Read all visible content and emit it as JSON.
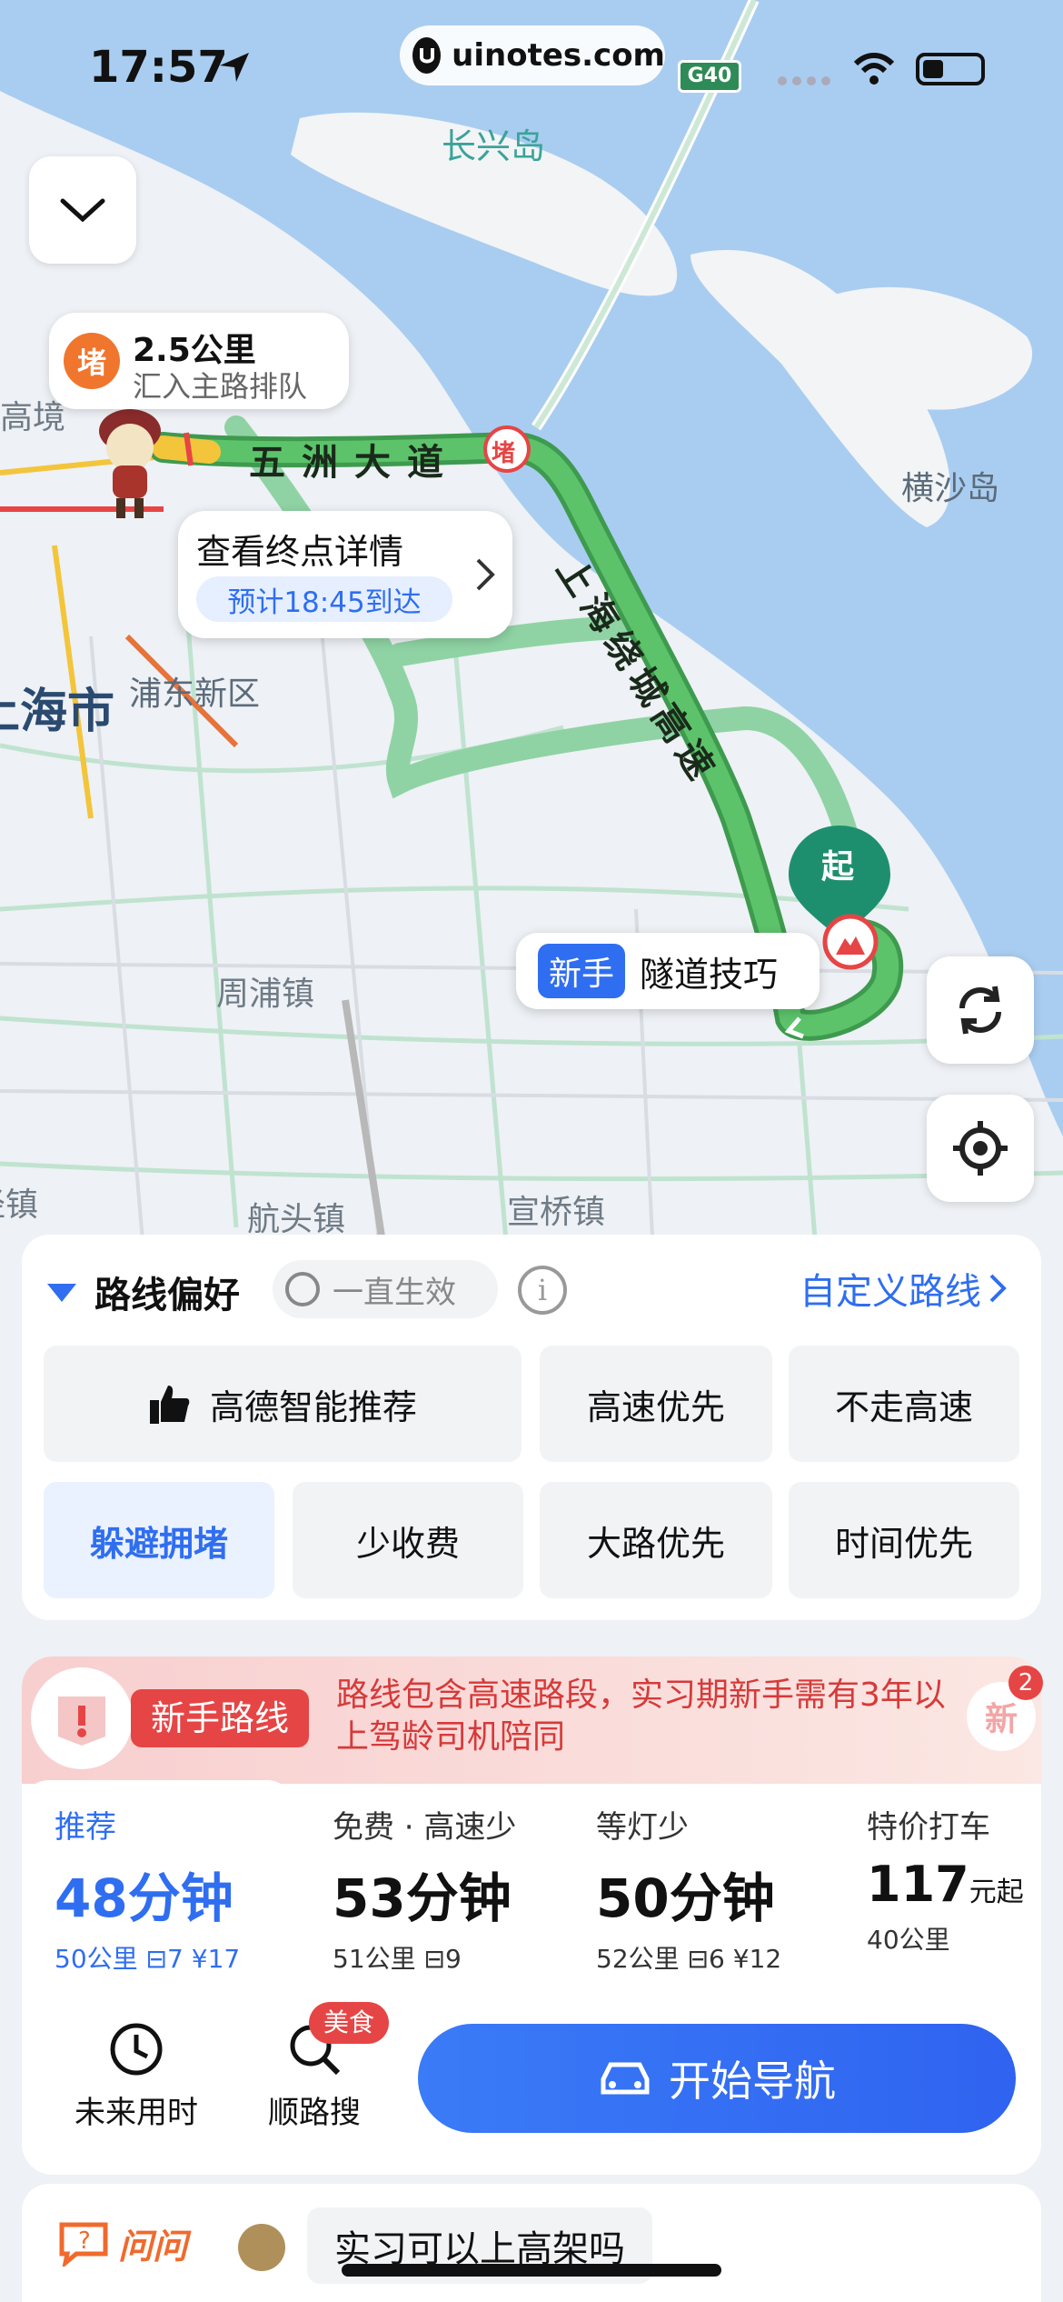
{
  "status_bar": {
    "time": "17:57",
    "url": "uinotes.com",
    "highway_sign": "G40"
  },
  "map": {
    "labels": {
      "changxing_island": "长兴岛",
      "hengsha_island": "横沙岛",
      "gaojing": "高境",
      "shanghai_city": "上海市",
      "pudong": "浦东新区",
      "zhoupu": "周浦镇",
      "hangtou": "航头镇",
      "xuanqiao": "宣桥镇",
      "jing_town": "泾镇"
    },
    "road_wuzhou": "五洲大道",
    "road_ring": "上海绕城高速",
    "jam_marker": "堵",
    "start_marker": "起"
  },
  "jam_bubble": {
    "badge": "堵",
    "distance": "2.5公里",
    "desc": "汇入主路排队"
  },
  "dest_bubble": {
    "title": "查看终点详情",
    "eta": "预计18:45到达"
  },
  "tip_bubble": {
    "badge": "新手",
    "text": "隧道技巧"
  },
  "preferences": {
    "title": "路线偏好",
    "toggle_label": "一直生效",
    "custom_link": "自定义路线",
    "row1": [
      "高德智能推荐",
      "高速优先",
      "不走高速"
    ],
    "row2": [
      "躲避拥堵",
      "少收费",
      "大路优先",
      "时间优先"
    ],
    "active": "躲避拥堵"
  },
  "novice_banner": {
    "tag": "新手路线",
    "message": "路线包含高速路段，实习期新手需有3年以上驾龄司机陪同",
    "badge_text": "新",
    "badge_count": "2"
  },
  "routes": [
    {
      "name": "推荐",
      "time": "48分钟",
      "distance": "50公里",
      "lights": "7",
      "toll": "¥17"
    },
    {
      "name": "免费 · 高速少",
      "time": "53分钟",
      "distance": "51公里",
      "lights": "9",
      "toll": ""
    },
    {
      "name": "等灯少",
      "time": "50分钟",
      "distance": "52公里",
      "lights": "6",
      "toll": "¥12"
    },
    {
      "name": "特价打车",
      "price": "117",
      "price_suffix": "元起",
      "distance": "40公里"
    }
  ],
  "actions": {
    "future_time": "未来用时",
    "along_search": "顺路搜",
    "food_badge": "美食",
    "start_nav": "开始导航"
  },
  "ask": {
    "label": "问问",
    "question": "实习可以上高架吗"
  },
  "colors": {
    "accent_blue": "#2f6ef0",
    "route_green": "#4caf5a",
    "jam_orange": "#f0752d",
    "danger_red": "#e64545",
    "water": "#a9cdf0"
  }
}
